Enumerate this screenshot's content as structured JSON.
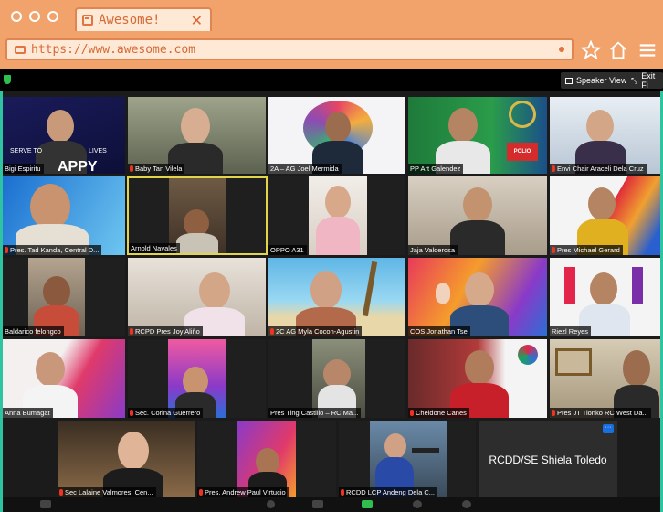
{
  "browser": {
    "tab_title": "Awesome!",
    "url": "https://www.awesome.com"
  },
  "zoom": {
    "speaker_view_label": "Speaker View",
    "exit_label": "Exit Fi"
  },
  "participants": [
    {
      "name": "Bigi Espiritu"
    },
    {
      "name": "Baby Tan Vilela"
    },
    {
      "name": "2A – AG Joel Mermida"
    },
    {
      "name": "PP Art Galendez"
    },
    {
      "name": "Envi Chair Araceli Dela Cruz"
    },
    {
      "name": "Pres. Tad Kanda, Central D..."
    },
    {
      "name": "Arnold Navales"
    },
    {
      "name": "OPPO A31"
    },
    {
      "name": "Jaja Valderosa"
    },
    {
      "name": "Pres Michael Gerard"
    },
    {
      "name": "Baldarico felongco"
    },
    {
      "name": "RCPD Pres Joy Aliño"
    },
    {
      "name": "2C AG Myla Cocon-Agustin"
    },
    {
      "name": "COS Jonathan Tse"
    },
    {
      "name": "Riezl Reyes"
    },
    {
      "name": "Anna Bumagat"
    },
    {
      "name": "Sec. Corina Guerrero"
    },
    {
      "name": "Pres Ting Castillo – RC Ma..."
    },
    {
      "name": "Cheldone Canes"
    },
    {
      "name": "Pres JT Tionko RC West Da..."
    },
    {
      "name": "Sec Lalaine Valmores, Cen..."
    },
    {
      "name": "Pres. Andrew Paul Virtucio"
    },
    {
      "name": "RCDD LCP Andeng Dela C..."
    },
    {
      "name": "RCDD/SE Shiela Toledo"
    }
  ],
  "overlay_text": {
    "serve_to": "SERVE TO",
    "lives": "LIVES",
    "happy_new": "APPY NEW",
    "polio": "POLIO"
  },
  "colors": {
    "browser": "#f2a36b",
    "accent_teal": "#2ec4a0",
    "active_speaker": "#e3d54a"
  }
}
